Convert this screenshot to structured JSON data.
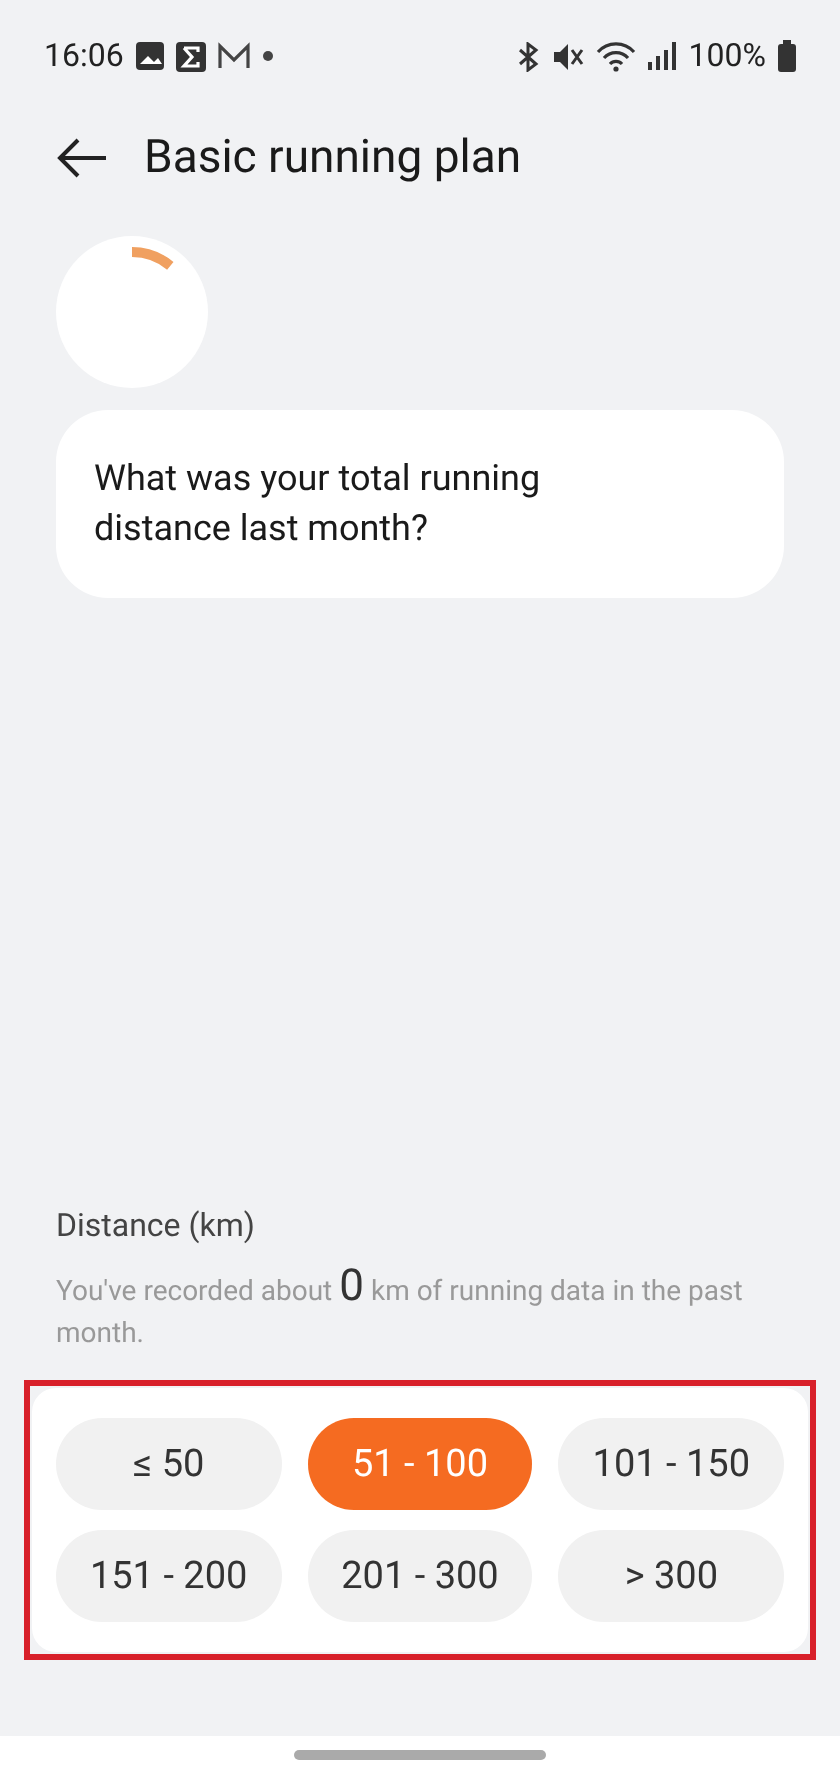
{
  "status_bar": {
    "time": "16:06",
    "battery": "100%"
  },
  "header": {
    "title": "Basic running plan"
  },
  "question": "What was your total running distance last month?",
  "distance": {
    "label": "Distance (km)",
    "hint_before": "You've recorded about",
    "hint_value": "0",
    "hint_after": "km of running data in the past month."
  },
  "options": [
    {
      "label": "≤ 50",
      "selected": false
    },
    {
      "label": "51 - 100",
      "selected": true
    },
    {
      "label": "101 - 150",
      "selected": false
    },
    {
      "label": "151 - 200",
      "selected": false
    },
    {
      "label": "201 - 300",
      "selected": false
    },
    {
      "label": "> 300",
      "selected": false
    }
  ]
}
